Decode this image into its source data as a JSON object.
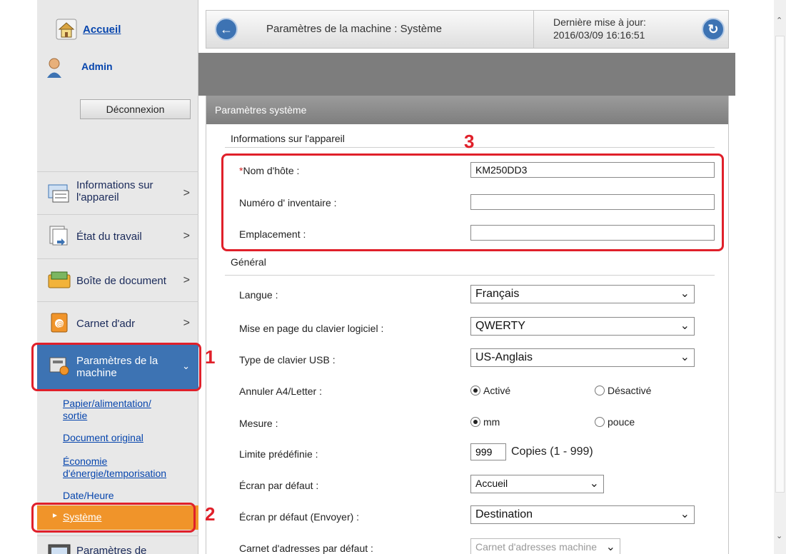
{
  "sidebar": {
    "home_label": "Accueil",
    "user_name": "Admin",
    "logout_label": "Déconnexion",
    "items": [
      {
        "label_line1": "Informations sur",
        "label_line2": "l'appareil",
        "icon": "device-info-icon"
      },
      {
        "label_line1": "État du travail",
        "icon": "job-status-icon"
      },
      {
        "label_line1": "Boîte de document",
        "icon": "document-box-icon"
      },
      {
        "label_line1": "Carnet d'adr",
        "icon": "address-book-icon"
      },
      {
        "label_line1": "Paramètres de la",
        "label_line2": "machine",
        "icon": "machine-settings-icon"
      },
      {
        "label_line1": "Paramètres de",
        "icon": "settings-icon"
      }
    ],
    "sub_items": [
      {
        "line1": "Papier/alimentation/",
        "line2": "sortie"
      },
      {
        "line1": "Document original"
      },
      {
        "line1": "Économie",
        "line2": "d'énergie/temporisation"
      },
      {
        "line1": "Date/Heure"
      },
      {
        "line1": "Système"
      }
    ]
  },
  "header": {
    "title": "Paramètres de la machine : Système",
    "update_label": "Dernière mise à jour:",
    "update_time": "2016/03/09 16:16:51"
  },
  "panel": {
    "title": "Paramètres système",
    "device_section": "Informations sur l'appareil",
    "hostname_label": "Nom d'hôte :",
    "hostname_value": "KM250DD3",
    "asset_label": "Numéro d' inventaire :",
    "asset_value": "",
    "location_label": "Emplacement :",
    "location_value": "",
    "general_section": "Général",
    "language_label": "Langue :",
    "language_value": "Français",
    "keyboard_layout_label": "Mise en page du clavier logiciel :",
    "keyboard_layout_value": "QWERTY",
    "usb_keyboard_label": "Type de clavier USB :",
    "usb_keyboard_value": "US-Anglais",
    "a4letter_label": "Annuler A4/Letter :",
    "a4letter_on": "Activé",
    "a4letter_off": "Désactivé",
    "measure_label": "Mesure :",
    "measure_mm": "mm",
    "measure_inch": "pouce",
    "limit_label": "Limite prédéfinie :",
    "limit_value": "999",
    "limit_unit": "Copies (1 - 999)",
    "default_screen_label": "Écran par défaut :",
    "default_screen_value": "Accueil",
    "default_send_label": "Écran pr défaut (Envoyer) :",
    "default_send_value": "Destination",
    "default_addrbook_label": "Carnet d'adresses par défaut :",
    "default_addrbook_value": "Carnet d'adresses machine"
  },
  "annotations": {
    "step1": "1",
    "step2": "2",
    "step3": "3"
  },
  "colors": {
    "accent": "#3d73b3",
    "highlight": "#f0942a",
    "annotation": "#e0202a"
  }
}
